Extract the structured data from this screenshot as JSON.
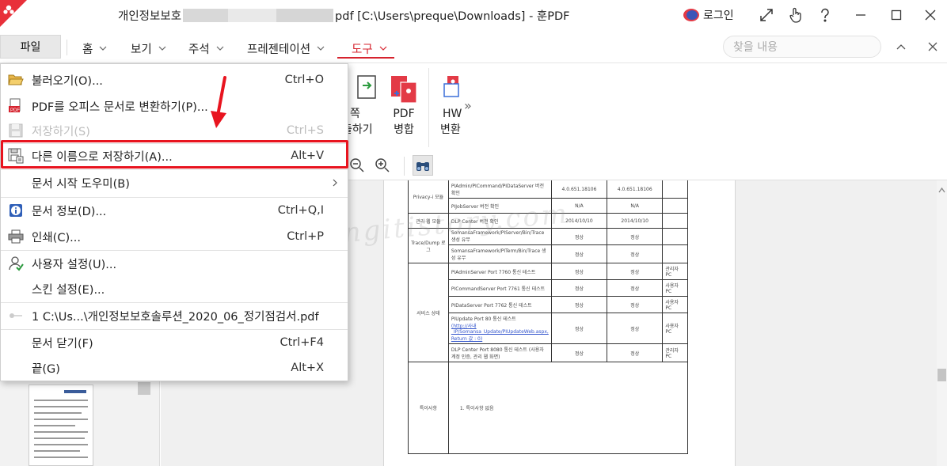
{
  "window": {
    "title_prefix": "개인정보보호",
    "title_suffix": "pdf [C:\\Users\\preque\\Downloads] - 훈PDF",
    "login_label": "로그인",
    "icons": [
      "app-logo-icon",
      "avatar-icon",
      "fullscreen-icon",
      "touch-mode-icon",
      "help-icon",
      "minimize-icon",
      "maximize-icon",
      "close-icon"
    ]
  },
  "tabs": {
    "file": "파일",
    "items": [
      "홈",
      "보기",
      "주석",
      "프레젠테이션",
      "도구"
    ],
    "active": "도구",
    "search_placeholder": "찾을 내용"
  },
  "ribbon": {
    "partial_button_line1": "쪽",
    "partial_button_line2": "출하기",
    "merge_line1": "PDF",
    "merge_line2": "병합",
    "hwp_line1": "HW",
    "hwp_line2": "변환",
    "more": "»"
  },
  "file_menu": {
    "items": [
      {
        "label": "불러오기(O)...",
        "key": "Ctrl+O",
        "icon": "folder-open-icon"
      },
      {
        "label": "PDF를 오피스 문서로 변환하기(P)...",
        "key": "",
        "icon": "pdf-convert-icon"
      },
      {
        "label": "저장하기(S)",
        "key": "Ctrl+S",
        "icon": "save-icon",
        "disabled": true
      },
      {
        "label": "다른 이름으로 저장하기(A)...",
        "key": "Alt+V",
        "icon": "save-as-icon",
        "highlighted": true
      },
      {
        "label": "문서 시작 도우미(B)",
        "key": "",
        "icon": "",
        "submenu": true
      },
      {
        "label": "문서 정보(D)...",
        "key": "Ctrl+Q,I",
        "icon": "info-icon"
      },
      {
        "label": "인쇄(C)...",
        "key": "Ctrl+P",
        "icon": "print-icon"
      },
      {
        "label": "사용자 설정(U)...",
        "key": "",
        "icon": "user-settings-icon"
      },
      {
        "label": "스킨 설정(E)...",
        "key": "",
        "icon": ""
      },
      {
        "label": "1 C:\\Us...\\개인정보보호솔루션_2020_06_정기점검서.pdf",
        "key": "",
        "icon": "pin-icon"
      },
      {
        "label": "문서 닫기(F)",
        "key": "Ctrl+F4",
        "icon": ""
      },
      {
        "label": "끝(G)",
        "key": "Alt+X",
        "icon": ""
      }
    ]
  },
  "document": {
    "watermark": "springitistory.com",
    "rows": [
      {
        "group": "Privacy-i 모듈",
        "item": "PIAdmin/PICommand/PIDataServer 버전 확인",
        "v1": "4.0.651.18106",
        "v2": "4.0.651.18106",
        "note": ""
      },
      {
        "group": "",
        "item": "PIJobServer 버전 확인",
        "v1": "N/A",
        "v2": "N/A",
        "note": ""
      },
      {
        "group": "관리 웹 모듈",
        "item": "DLP Center 버전 확인",
        "v1": "2014/10/10",
        "v2": "2014/10/10",
        "note": ""
      },
      {
        "group": "Trace/Dump 로그",
        "item": "SomansaFramework/PIServer/Bin/Trace 생성 유무",
        "v1": "정상",
        "v2": "정상",
        "note": ""
      },
      {
        "group": "",
        "item": "SomansaFramework/PITerm/Bin/Trace 생성 유무",
        "v1": "정상",
        "v2": "정상",
        "note": ""
      },
      {
        "group": "서비스 상태",
        "item": "PIAdminServer Port 7760 통신 테스트",
        "v1": "정상",
        "v2": "정상",
        "note": "관리자 PC"
      },
      {
        "group": "",
        "item": "PICommandServer Port 7761 통신 테스트",
        "v1": "정상",
        "v2": "정상",
        "note": "사용자 PC"
      },
      {
        "group": "",
        "item": "PIDataServer Port 7762 통신 테스트",
        "v1": "정상",
        "v2": "정상",
        "note": "사용자 PC"
      },
      {
        "group": "",
        "item": "PIUpdate Port 80 통신 테스트",
        "link": "(http://사내_IP/Somansa_Update/PIUpdateWeb.aspx, Return 값 : 0)",
        "v1": "정상",
        "v2": "정상",
        "note": "사용자 PC"
      },
      {
        "group": "",
        "item": "DLP Center Port 8080 통신 테스트 (사용자 계정 인증, 관리 웹 화면)",
        "v1": "정상",
        "v2": "정상",
        "note": "관리자 PC"
      }
    ],
    "special_label": "특이사항",
    "special_text": "1.   특이사항 없음"
  }
}
